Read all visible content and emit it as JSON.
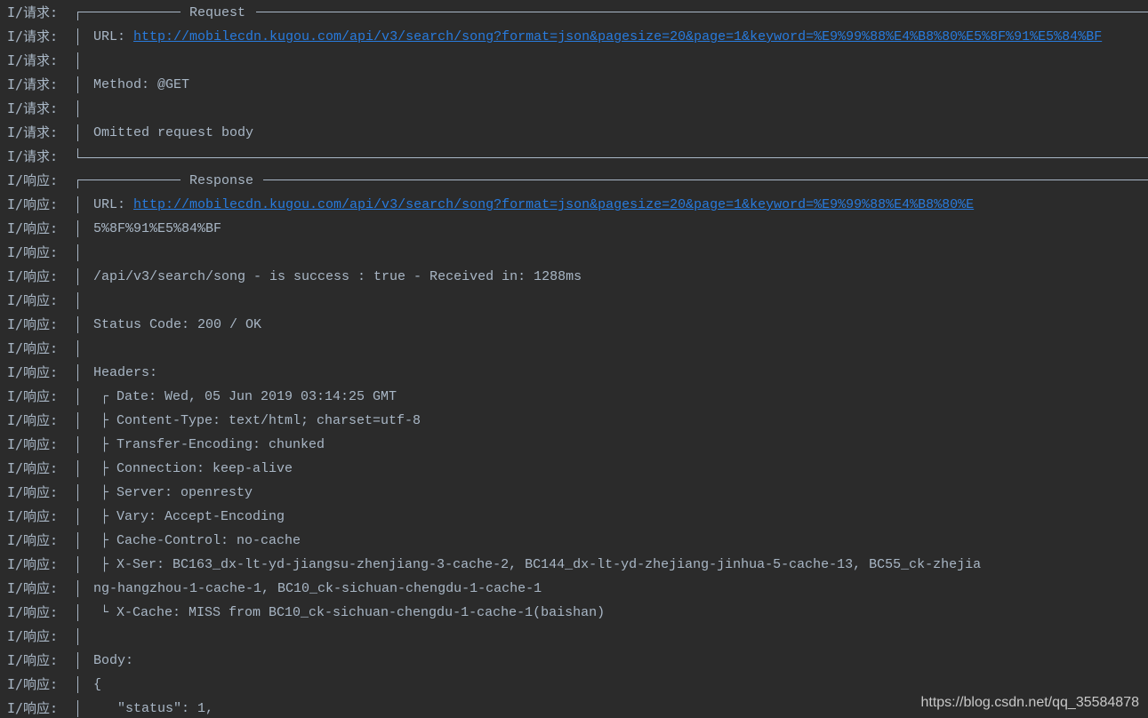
{
  "tags": {
    "request": "I/请求:",
    "response": "I/响应:"
  },
  "request": {
    "title": "Request",
    "url_label": "URL: ",
    "url": "http://mobilecdn.kugou.com/api/v3/search/song?format=json&pagesize=20&page=1&keyword=%E9%99%88%E4%B8%80%E5%8F%91%E5%84%BF",
    "method": "Method: @GET",
    "body_note": "Omitted request body"
  },
  "response": {
    "title": "Response",
    "url_label": "URL: ",
    "url": "http://mobilecdn.kugou.com/api/v3/search/song?format=json&pagesize=20&page=1&keyword=%E9%99%88%E4%B8%80%E",
    "url_cont": "5%8F%91%E5%84%BF",
    "summary": "/api/v3/search/song - is success : true - Received in: 1288ms",
    "status": "Status Code: 200 / OK",
    "headers_label": "Headers:",
    "headers": [
      "┌ Date: Wed, 05 Jun 2019 03:14:25 GMT",
      "├ Content-Type: text/html; charset=utf-8",
      "├ Transfer-Encoding: chunked",
      "├ Connection: keep-alive",
      "├ Server: openresty",
      "├ Vary: Accept-Encoding",
      "├ Cache-Control: no-cache",
      "├ X-Ser: BC163_dx-lt-yd-jiangsu-zhenjiang-3-cache-2, BC144_dx-lt-yd-zhejiang-jinhua-5-cache-13, BC55_ck-zhejia"
    ],
    "xser_cont": "ng-hangzhou-1-cache-1, BC10_ck-sichuan-chengdu-1-cache-1",
    "xcache": "└ X-Cache: MISS from BC10_ck-sichuan-chengdu-1-cache-1(baishan)",
    "body_label": "Body:",
    "body_open": "{",
    "body_status": "\"status\": 1,"
  },
  "watermark": "https://blog.csdn.net/qq_35584878",
  "colors": {
    "background": "#2b2b2b",
    "text": "#a9b7c6",
    "link": "#287bde"
  }
}
